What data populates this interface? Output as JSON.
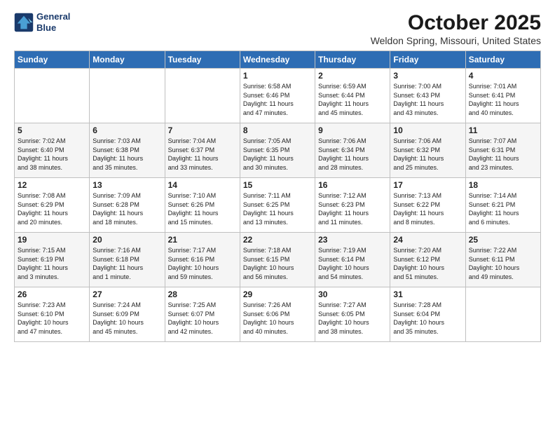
{
  "header": {
    "logo_line1": "General",
    "logo_line2": "Blue",
    "month": "October 2025",
    "location": "Weldon Spring, Missouri, United States"
  },
  "weekdays": [
    "Sunday",
    "Monday",
    "Tuesday",
    "Wednesday",
    "Thursday",
    "Friday",
    "Saturday"
  ],
  "weeks": [
    [
      {
        "day": "",
        "info": ""
      },
      {
        "day": "",
        "info": ""
      },
      {
        "day": "",
        "info": ""
      },
      {
        "day": "1",
        "info": "Sunrise: 6:58 AM\nSunset: 6:46 PM\nDaylight: 11 hours\nand 47 minutes."
      },
      {
        "day": "2",
        "info": "Sunrise: 6:59 AM\nSunset: 6:44 PM\nDaylight: 11 hours\nand 45 minutes."
      },
      {
        "day": "3",
        "info": "Sunrise: 7:00 AM\nSunset: 6:43 PM\nDaylight: 11 hours\nand 43 minutes."
      },
      {
        "day": "4",
        "info": "Sunrise: 7:01 AM\nSunset: 6:41 PM\nDaylight: 11 hours\nand 40 minutes."
      }
    ],
    [
      {
        "day": "5",
        "info": "Sunrise: 7:02 AM\nSunset: 6:40 PM\nDaylight: 11 hours\nand 38 minutes."
      },
      {
        "day": "6",
        "info": "Sunrise: 7:03 AM\nSunset: 6:38 PM\nDaylight: 11 hours\nand 35 minutes."
      },
      {
        "day": "7",
        "info": "Sunrise: 7:04 AM\nSunset: 6:37 PM\nDaylight: 11 hours\nand 33 minutes."
      },
      {
        "day": "8",
        "info": "Sunrise: 7:05 AM\nSunset: 6:35 PM\nDaylight: 11 hours\nand 30 minutes."
      },
      {
        "day": "9",
        "info": "Sunrise: 7:06 AM\nSunset: 6:34 PM\nDaylight: 11 hours\nand 28 minutes."
      },
      {
        "day": "10",
        "info": "Sunrise: 7:06 AM\nSunset: 6:32 PM\nDaylight: 11 hours\nand 25 minutes."
      },
      {
        "day": "11",
        "info": "Sunrise: 7:07 AM\nSunset: 6:31 PM\nDaylight: 11 hours\nand 23 minutes."
      }
    ],
    [
      {
        "day": "12",
        "info": "Sunrise: 7:08 AM\nSunset: 6:29 PM\nDaylight: 11 hours\nand 20 minutes."
      },
      {
        "day": "13",
        "info": "Sunrise: 7:09 AM\nSunset: 6:28 PM\nDaylight: 11 hours\nand 18 minutes."
      },
      {
        "day": "14",
        "info": "Sunrise: 7:10 AM\nSunset: 6:26 PM\nDaylight: 11 hours\nand 15 minutes."
      },
      {
        "day": "15",
        "info": "Sunrise: 7:11 AM\nSunset: 6:25 PM\nDaylight: 11 hours\nand 13 minutes."
      },
      {
        "day": "16",
        "info": "Sunrise: 7:12 AM\nSunset: 6:23 PM\nDaylight: 11 hours\nand 11 minutes."
      },
      {
        "day": "17",
        "info": "Sunrise: 7:13 AM\nSunset: 6:22 PM\nDaylight: 11 hours\nand 8 minutes."
      },
      {
        "day": "18",
        "info": "Sunrise: 7:14 AM\nSunset: 6:21 PM\nDaylight: 11 hours\nand 6 minutes."
      }
    ],
    [
      {
        "day": "19",
        "info": "Sunrise: 7:15 AM\nSunset: 6:19 PM\nDaylight: 11 hours\nand 3 minutes."
      },
      {
        "day": "20",
        "info": "Sunrise: 7:16 AM\nSunset: 6:18 PM\nDaylight: 11 hours\nand 1 minute."
      },
      {
        "day": "21",
        "info": "Sunrise: 7:17 AM\nSunset: 6:16 PM\nDaylight: 10 hours\nand 59 minutes."
      },
      {
        "day": "22",
        "info": "Sunrise: 7:18 AM\nSunset: 6:15 PM\nDaylight: 10 hours\nand 56 minutes."
      },
      {
        "day": "23",
        "info": "Sunrise: 7:19 AM\nSunset: 6:14 PM\nDaylight: 10 hours\nand 54 minutes."
      },
      {
        "day": "24",
        "info": "Sunrise: 7:20 AM\nSunset: 6:12 PM\nDaylight: 10 hours\nand 51 minutes."
      },
      {
        "day": "25",
        "info": "Sunrise: 7:22 AM\nSunset: 6:11 PM\nDaylight: 10 hours\nand 49 minutes."
      }
    ],
    [
      {
        "day": "26",
        "info": "Sunrise: 7:23 AM\nSunset: 6:10 PM\nDaylight: 10 hours\nand 47 minutes."
      },
      {
        "day": "27",
        "info": "Sunrise: 7:24 AM\nSunset: 6:09 PM\nDaylight: 10 hours\nand 45 minutes."
      },
      {
        "day": "28",
        "info": "Sunrise: 7:25 AM\nSunset: 6:07 PM\nDaylight: 10 hours\nand 42 minutes."
      },
      {
        "day": "29",
        "info": "Sunrise: 7:26 AM\nSunset: 6:06 PM\nDaylight: 10 hours\nand 40 minutes."
      },
      {
        "day": "30",
        "info": "Sunrise: 7:27 AM\nSunset: 6:05 PM\nDaylight: 10 hours\nand 38 minutes."
      },
      {
        "day": "31",
        "info": "Sunrise: 7:28 AM\nSunset: 6:04 PM\nDaylight: 10 hours\nand 35 minutes."
      },
      {
        "day": "",
        "info": ""
      }
    ]
  ]
}
